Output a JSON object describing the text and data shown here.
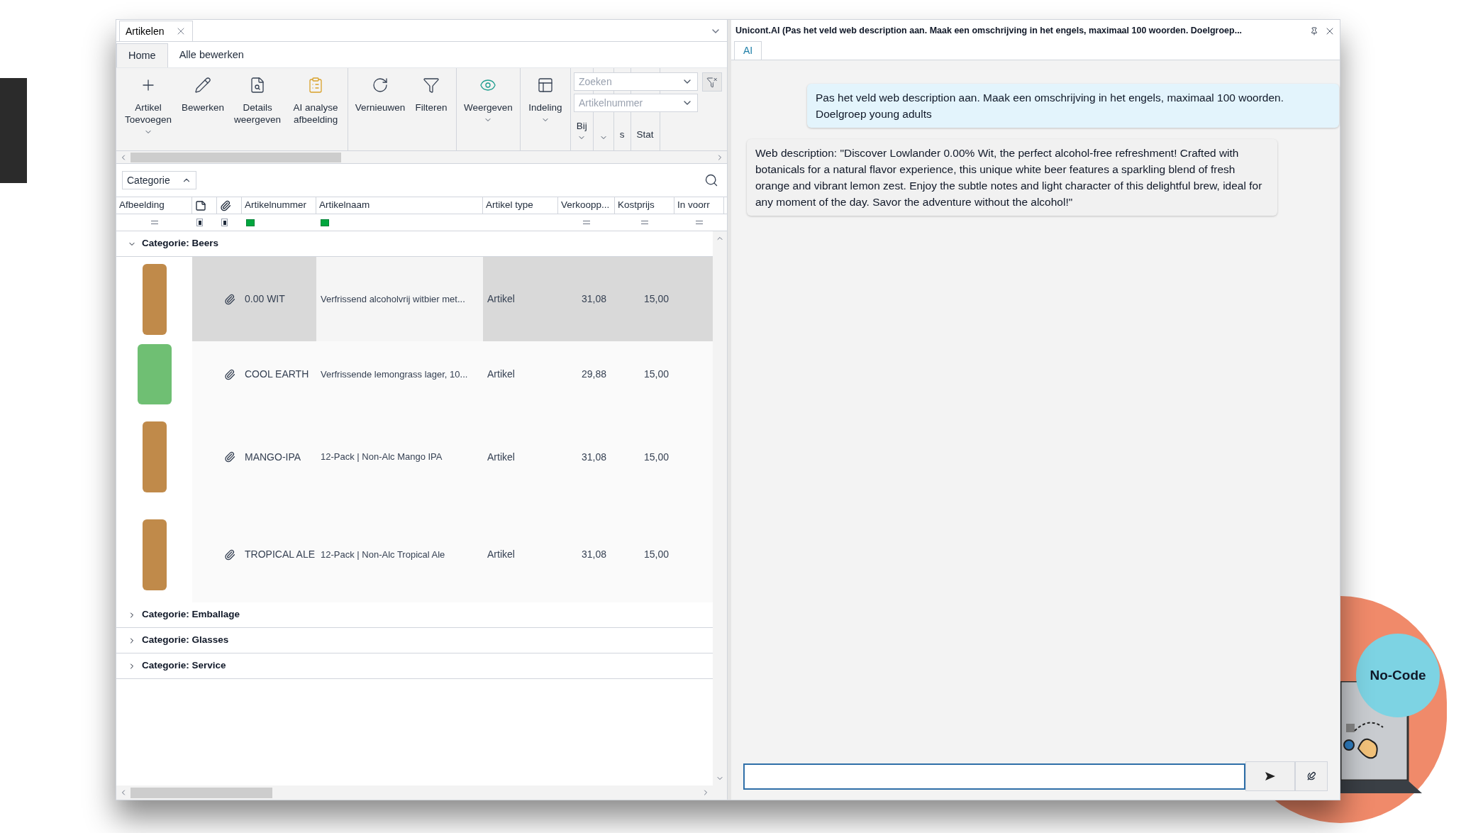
{
  "left_panel": {
    "doc_tab": {
      "label": "Artikelen",
      "selected": true
    },
    "ribbon_tabs": [
      {
        "label": "Home",
        "selected": true
      },
      {
        "label": "Alle bewerken",
        "selected": false
      }
    ],
    "ribbon_groups": [
      [
        {
          "label": "Artikel Toevoegen",
          "dropdown": true
        },
        {
          "label": "Bewerken",
          "dropdown": false
        },
        {
          "label": "Details weergeven",
          "dropdown": false
        },
        {
          "label": "AI analyse afbeelding",
          "dropdown": false
        }
      ],
      [
        {
          "label": "Vernieuwen",
          "dropdown": false
        },
        {
          "label": "Filteren",
          "dropdown": false
        }
      ],
      [
        {
          "label": "Weergeven",
          "dropdown": true
        }
      ],
      [
        {
          "label": "Indeling",
          "dropdown": true
        }
      ]
    ],
    "ribbon_covered": [
      {
        "label": "Bij",
        "dropdown": true
      },
      {
        "dropdown": true
      },
      {
        "label": "s",
        "dropdown": false
      },
      {
        "label": "Stat",
        "dropdown": false
      }
    ],
    "search": {
      "placeholder": "Zoeken"
    },
    "search_field": {
      "placeholder": "Artikelnummer"
    },
    "group_by": {
      "label": "Categorie"
    },
    "columns": [
      {
        "kind": "text",
        "label": "Afbeelding"
      },
      {
        "kind": "icon"
      },
      {
        "kind": "icon"
      },
      {
        "kind": "text",
        "label": "Artikelnummer"
      },
      {
        "kind": "text",
        "label": "Artikelnaam"
      },
      {
        "kind": "text",
        "label": "Artikel type"
      },
      {
        "kind": "text",
        "label": "Verkoopp..."
      },
      {
        "kind": "text",
        "label": "Kostprijs"
      },
      {
        "kind": "text",
        "label": "In voorr"
      }
    ],
    "groups": [
      {
        "label": "Categorie: Beers",
        "expanded": true,
        "rows": [
          {
            "artikelnummer": "0.00 WIT",
            "artikelnaam": "Verfrissend alcoholvrij witbier met...",
            "artikel_type": "Artikel",
            "verkoopprijs": "31,08",
            "kostprijs": "15,00",
            "attachment": true,
            "selected": true
          },
          {
            "artikelnummer": "COOL EARTH",
            "artikelnaam": "Verfrissende lemongrass lager, 10...",
            "artikel_type": "Artikel",
            "verkoopprijs": "29,88",
            "kostprijs": "15,00",
            "attachment": true,
            "selected": false
          },
          {
            "artikelnummer": "MANGO-IPA",
            "artikelnaam": "12-Pack | Non-Alc Mango IPA",
            "artikel_type": "Artikel",
            "verkoopprijs": "31,08",
            "kostprijs": "15,00",
            "attachment": true,
            "selected": false
          },
          {
            "artikelnummer": "TROPICAL ALE",
            "artikelnaam": "12-Pack | Non-Alc Tropical Ale",
            "artikel_type": "Artikel",
            "verkoopprijs": "31,08",
            "kostprijs": "15,00",
            "attachment": true,
            "selected": false
          }
        ]
      },
      {
        "label": "Categorie: Emballage",
        "expanded": false
      },
      {
        "label": "Categorie: Glasses",
        "expanded": false
      },
      {
        "label": "Categorie: Service",
        "expanded": false
      }
    ]
  },
  "ai_panel": {
    "title": "Unicont.AI (Pas het veld web description aan. Maak een omschrijving in het engels, maximaal 100 woorden. Doelgroep...",
    "tabs": [
      {
        "label": "AI",
        "selected": true
      }
    ],
    "messages": [
      {
        "kind": "user",
        "text": "Pas het veld web description aan. Maak een omschrijving in het engels, maximaal 100 woorden. Doelgroep young adults"
      },
      {
        "kind": "assistant",
        "text": "Web description: \"Discover Lowlander 0.00% Wit, the perfect alcohol-free refreshment! Crafted with botanicals for a natural flavor experience, this unique white beer features a sparkling blend of fresh orange and vibrant lemon zest. Enjoy the subtle notes and light character of this delightful brew, ideal for any moment of the day. Savor the adventure without the alcohol!\""
      }
    ]
  },
  "badge": {
    "label": "No-Code"
  }
}
